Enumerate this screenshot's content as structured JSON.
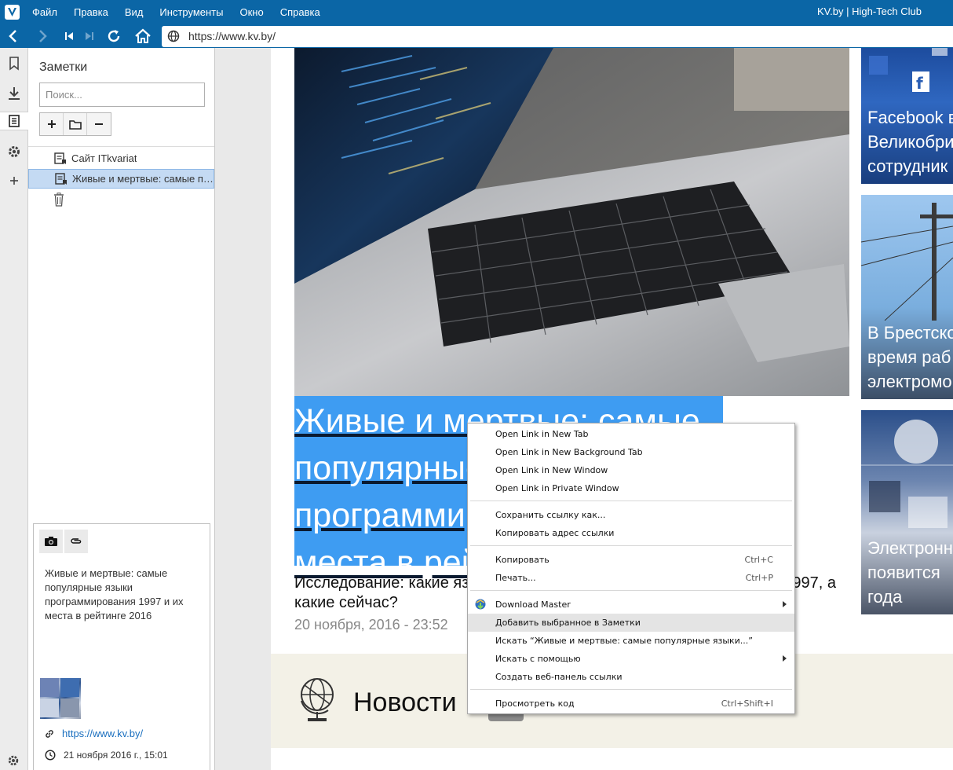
{
  "menubar": {
    "items": [
      "Файл",
      "Правка",
      "Вид",
      "Инструменты",
      "Окно",
      "Справка"
    ],
    "window_title": "KV.by | High-Tech Club"
  },
  "address": {
    "url": "https://www.kv.by/"
  },
  "notes_panel": {
    "title": "Заметки",
    "search_placeholder": "Поиск...",
    "tree": [
      {
        "label": "Сайт ITkvariat"
      },
      {
        "label": "Живые и мертвые: самые популярные языки"
      }
    ],
    "detail": {
      "text": "Живые и мертвые: самые популярные языки программирования 1997 и их места в рейтинге 2016",
      "url": "https://www.kv.by/",
      "date": "21 ноября 2016 г., 15:01"
    }
  },
  "article": {
    "headline_lines": [
      "Живые и мертвые: самые",
      "популярные языки",
      "программирования",
      "места в рейтинге"
    ],
    "subtitle": "Исследование: какие языки программирования были популярны в 1997, а какие сейчас?",
    "date": "20 ноября, 2016 - 23:52",
    "news_title": "Новости"
  },
  "side_cards": [
    {
      "lines": [
        "Facebook в",
        "Великобри",
        "сотрудник"
      ]
    },
    {
      "lines": [
        "В Брестско",
        "время раб",
        "электромо"
      ]
    },
    {
      "lines": [
        "Электронн",
        "появится",
        "года"
      ]
    }
  ],
  "context_menu": {
    "items": [
      {
        "label": "Open Link in New Tab"
      },
      {
        "label": "Open Link in New Background Tab"
      },
      {
        "label": "Open Link in New Window"
      },
      {
        "label": "Open Link in Private Window"
      },
      {
        "label": "Сохранить ссылку как..."
      },
      {
        "label": "Копировать адрес ссылки"
      },
      {
        "label": "Копировать",
        "shortcut": "Ctrl+C"
      },
      {
        "label": "Печать...",
        "shortcut": "Ctrl+P"
      },
      {
        "label": "Download Master"
      },
      {
        "label": "Добавить выбранное в Заметки"
      },
      {
        "label": "Искать “Живые и мертвые: самые популярные языки...”"
      },
      {
        "label": "Искать с помощью"
      },
      {
        "label": "Создать веб-панель ссылки"
      },
      {
        "label": "Просмотреть код",
        "shortcut": "Ctrl+Shift+I"
      }
    ]
  },
  "colors": {
    "chrome_blue": "#0b66a6",
    "selection_blue": "#3e9cf2",
    "tree_selected": "#c4daf3",
    "link": "#1a6fbf"
  }
}
